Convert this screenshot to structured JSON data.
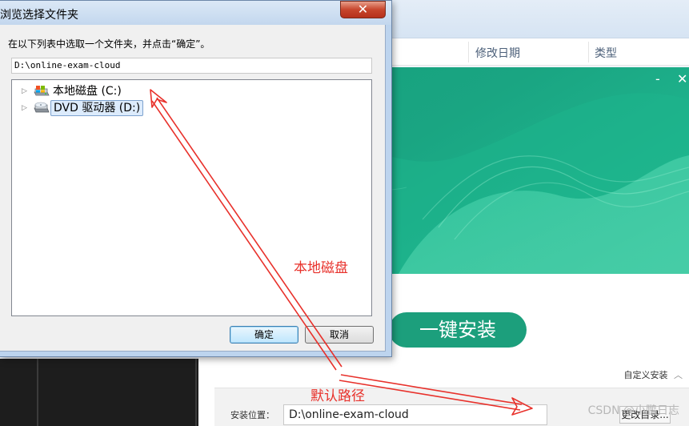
{
  "background_explorer": {
    "columns": [
      "修改日期",
      "类型"
    ]
  },
  "installer": {
    "window_controls": {
      "minimize": "-",
      "close": "✕"
    },
    "install_button": "一键安装",
    "custom_install": "自定义安装",
    "custom_install_chevron": "︿",
    "location_label": "安装位置：",
    "location_value": "D:\\online-exam-cloud",
    "change_dir_button": "更改目录..."
  },
  "dialog": {
    "title": "浏览选择文件夹",
    "close_glyph": "✕",
    "prompt": "在以下列表中选取一个文件夹，并点击“确定”。",
    "path_value": "D:\\online-exam-cloud",
    "tree": [
      {
        "label": "本地磁盘 (C:)",
        "icon": "hard-drive-icon",
        "selected": false
      },
      {
        "label": "DVD 驱动器 (D:)",
        "icon": "dvd-drive-icon",
        "selected": true
      }
    ],
    "expand_glyph": "▷",
    "ok_button": "确定",
    "cancel_button": "取消"
  },
  "annotations": {
    "local_disk": "本地磁盘",
    "default_path": "默认路径",
    "color": "#e8312b"
  },
  "watermark": "CSDN @小鹏日志",
  "colors": {
    "install_green": "#1c9f7c",
    "banner_green": "#1aa582",
    "dialog_frame": "#bdd4ee"
  }
}
